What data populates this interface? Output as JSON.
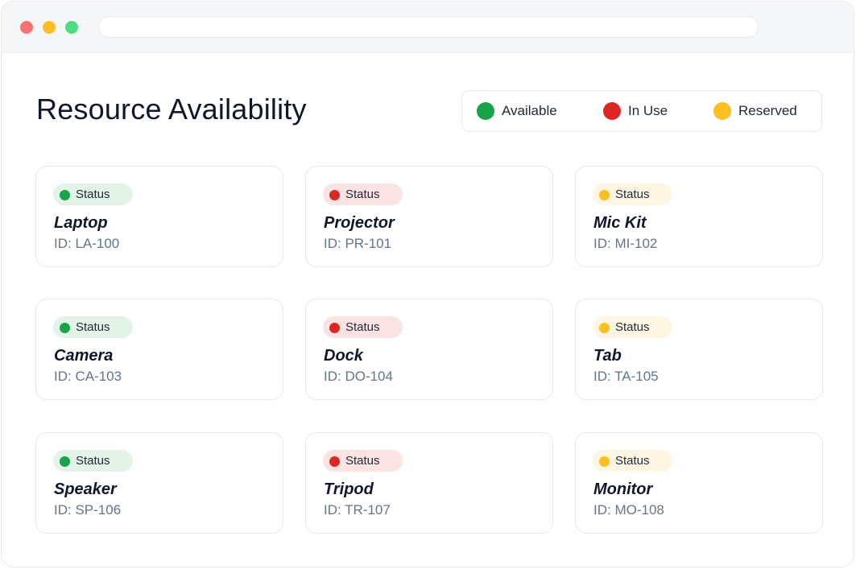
{
  "colors": {
    "available": "#16a34a",
    "in_use": "#dc2626",
    "reserved": "#fbbf24",
    "available_bg": "#e3f3e7",
    "in_use_bg": "#fce3e3",
    "reserved_bg": "#fef6e2",
    "traffic_red": "#f87171",
    "traffic_yellow": "#fbbf24",
    "traffic_green": "#4ade80"
  },
  "page": {
    "title": "Resource Availability"
  },
  "legend": {
    "available": "Available",
    "in_use": "In Use",
    "reserved": "Reserved"
  },
  "resources": [
    {
      "status_label": "Status",
      "status": "available",
      "name": "Laptop",
      "id": "ID: LA-100"
    },
    {
      "status_label": "Status",
      "status": "in_use",
      "name": "Projector",
      "id": "ID: PR-101"
    },
    {
      "status_label": "Status",
      "status": "reserved",
      "name": "Mic Kit",
      "id": "ID: MI-102"
    },
    {
      "status_label": "Status",
      "status": "available",
      "name": "Camera",
      "id": "ID: CA-103"
    },
    {
      "status_label": "Status",
      "status": "in_use",
      "name": "Dock",
      "id": "ID: DO-104"
    },
    {
      "status_label": "Status",
      "status": "reserved",
      "name": "Tab",
      "id": "ID: TA-105"
    },
    {
      "status_label": "Status",
      "status": "available",
      "name": "Speaker",
      "id": "ID: SP-106"
    },
    {
      "status_label": "Status",
      "status": "in_use",
      "name": "Tripod",
      "id": "ID: TR-107"
    },
    {
      "status_label": "Status",
      "status": "reserved",
      "name": "Monitor",
      "id": "ID: MO-108"
    }
  ]
}
